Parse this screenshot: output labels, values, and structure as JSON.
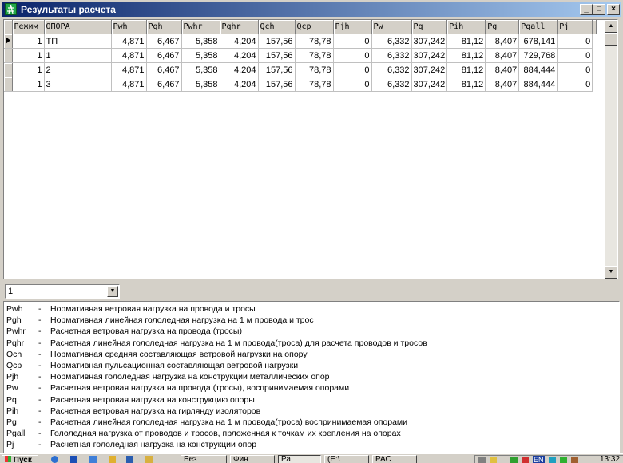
{
  "window": {
    "title": "Результаты расчета"
  },
  "title_buttons": {
    "minimize": "_",
    "maximize": "□",
    "close": "×"
  },
  "table": {
    "columns": [
      "Режим",
      "ОПОРА",
      "Pwh",
      "Pgh",
      "Pwhr",
      "Pqhr",
      "Qch",
      "Qcp",
      "Pjh",
      "Pw",
      "Pq",
      "Pih",
      "Pg",
      "Pgall",
      "Pj"
    ],
    "rows": [
      [
        "1",
        "ТП",
        "4,871",
        "6,467",
        "5,358",
        "4,204",
        "157,56",
        "78,78",
        "0",
        "6,332",
        "307,242",
        "81,12",
        "8,407",
        "678,141",
        "0"
      ],
      [
        "1",
        "1",
        "4,871",
        "6,467",
        "5,358",
        "4,204",
        "157,56",
        "78,78",
        "0",
        "6,332",
        "307,242",
        "81,12",
        "8,407",
        "729,768",
        "0"
      ],
      [
        "1",
        "2",
        "4,871",
        "6,467",
        "5,358",
        "4,204",
        "157,56",
        "78,78",
        "0",
        "6,332",
        "307,242",
        "81,12",
        "8,407",
        "884,444",
        "0"
      ],
      [
        "1",
        "3",
        "4,871",
        "6,467",
        "5,358",
        "4,204",
        "157,56",
        "78,78",
        "0",
        "6,332",
        "307,242",
        "81,12",
        "8,407",
        "884,444",
        "0"
      ]
    ],
    "current_row": 0
  },
  "combo": {
    "value": "1"
  },
  "legend": [
    {
      "code": "Pwh",
      "desc": "Нормативная ветровая нагрузка на провода и тросы"
    },
    {
      "code": "Pgh",
      "desc": "Нормативная линейная гололедная нагрузка на 1 м провода и трос"
    },
    {
      "code": "Pwhr",
      "desc": "Расчетная ветровая нагрузка на провода (тросы)"
    },
    {
      "code": "Pqhr",
      "desc": "Расчетная линейная гололедная  нагрузка  на 1 м провода(троса) для расчета проводов и тросов"
    },
    {
      "code": "Qch",
      "desc": "Нормативная средняя составляющая ветровой нагрузки на опору"
    },
    {
      "code": "Qcp",
      "desc": "Нормативная пульсационная составляющая ветровой нагрузки"
    },
    {
      "code": "Pjh",
      "desc": "Нормативная гололедная нагрузка на конструкции металлических опор"
    },
    {
      "code": "Pw",
      "desc": "Расчетная ветровая нагрузка на провода (тросы), воспринимаемая опорами"
    },
    {
      "code": "Pq",
      "desc": "Расчетная ветровая нагрузка на конструкцию опоры"
    },
    {
      "code": "Pih",
      "desc": "Расчетная ветровая нагрузка на гирлянду изоляторов"
    },
    {
      "code": "Pg",
      "desc": "Расчетная линейная гололедная  нагрузка  на 1 м провода(троса) воспринимаемая опорами"
    },
    {
      "code": "Pgall",
      "desc": "Гололедная нагрузка от проводов и тросов, прложенная к точкам их крепления на опорах"
    },
    {
      "code": "Pj",
      "desc": "Расчетная гололедная  нагрузка  на конструкции опор"
    }
  ],
  "taskbar": {
    "start": "Пуск",
    "tasks": [
      "Без",
      "Фин",
      "Ра",
      "(E:\\",
      "РАС"
    ],
    "clock": "13:32",
    "lang": "EN"
  },
  "colors": {
    "title_start": "#0a246a",
    "title_end": "#a6caf0",
    "face": "#d4d0c8"
  }
}
